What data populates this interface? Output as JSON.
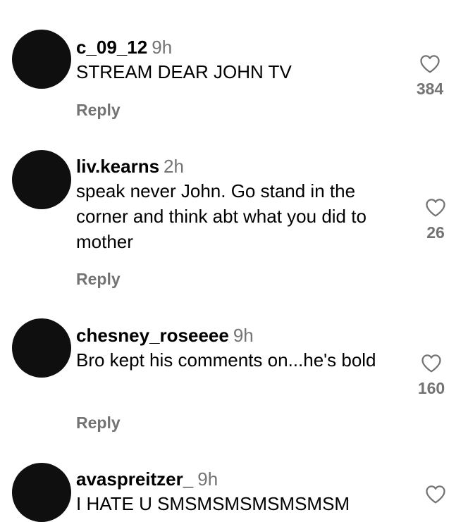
{
  "comments": [
    {
      "username": "c_09_12",
      "time": "9h",
      "text": "STREAM DEAR JOHN TV",
      "likes": "384",
      "reply_label": "Reply"
    },
    {
      "username": "liv.kearns",
      "time": "2h",
      "text": "speak never John. Go stand in the corner and think abt what you did to mother",
      "likes": "26",
      "reply_label": "Reply"
    },
    {
      "username": "chesney_roseeee",
      "time": "9h",
      "text": "Bro kept his comments on...he's bold",
      "likes": "160",
      "reply_label": "Reply"
    },
    {
      "username": "avaspreitzer_",
      "time": "9h",
      "text": "I HATE U SMSMSMSMSMSMSM",
      "likes": "",
      "reply_label": ""
    }
  ]
}
